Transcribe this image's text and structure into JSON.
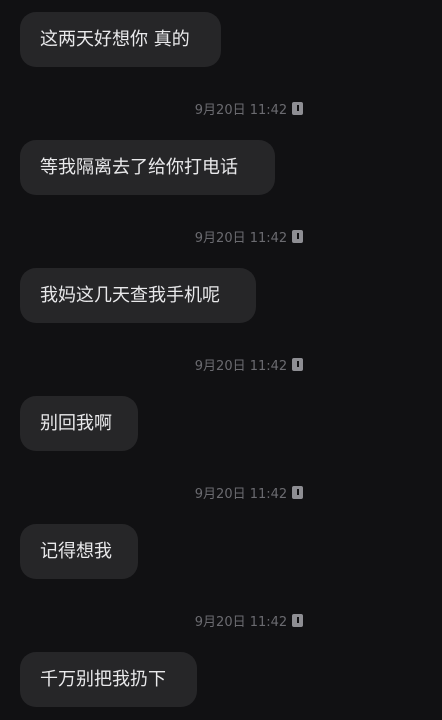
{
  "messages": [
    {
      "text": "这两天好想你 真的",
      "time": "9月20日 11:42",
      "status_icon": "read-receipt-icon"
    },
    {
      "text": "等我隔离去了给你打电话",
      "time": "9月20日 11:42",
      "status_icon": "read-receipt-icon"
    },
    {
      "text": "我妈这几天查我手机呢",
      "time": "9月20日 11:42",
      "status_icon": "read-receipt-icon"
    },
    {
      "text": "别回我啊",
      "time": "9月20日 11:42",
      "status_icon": "read-receipt-icon"
    },
    {
      "text": "记得想我",
      "time": "9月20日 11:42",
      "status_icon": "read-receipt-icon"
    },
    {
      "text": "千万别把我扔下"
    }
  ],
  "colors": {
    "background": "#111113",
    "bubble": "#262628",
    "message_text": "#e9e9eb",
    "timestamp_text": "#6b6b70"
  }
}
